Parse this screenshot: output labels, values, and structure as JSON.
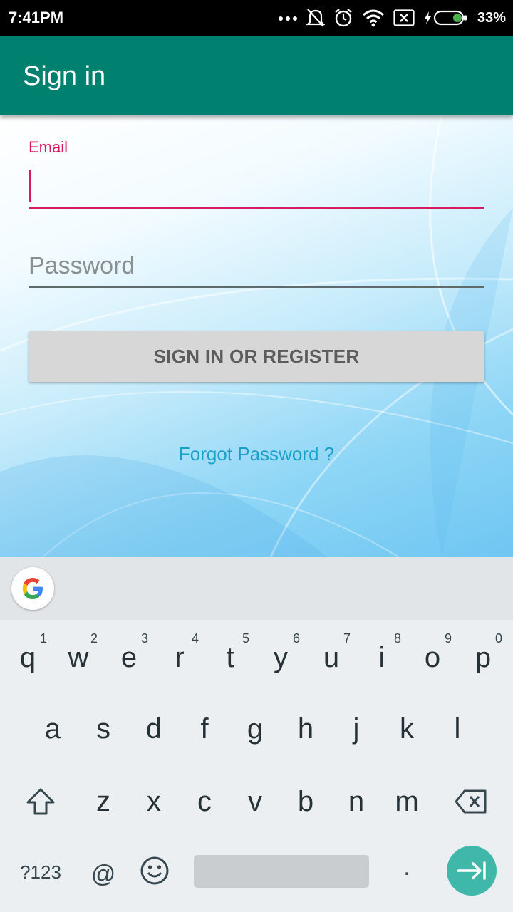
{
  "status_bar": {
    "time": "7:41PM",
    "battery": "33%"
  },
  "app_bar": {
    "title": "Sign in"
  },
  "form": {
    "email_label": "Email",
    "email_value": "",
    "password_placeholder": "Password",
    "submit_label": "SIGN IN OR REGISTER",
    "forgot_label": "Forgot Password ?"
  },
  "keyboard": {
    "row1": [
      {
        "key": "q",
        "hint": "1"
      },
      {
        "key": "w",
        "hint": "2"
      },
      {
        "key": "e",
        "hint": "3"
      },
      {
        "key": "r",
        "hint": "4"
      },
      {
        "key": "t",
        "hint": "5"
      },
      {
        "key": "y",
        "hint": "6"
      },
      {
        "key": "u",
        "hint": "7"
      },
      {
        "key": "i",
        "hint": "8"
      },
      {
        "key": "o",
        "hint": "9"
      },
      {
        "key": "p",
        "hint": "0"
      }
    ],
    "row2": [
      "a",
      "s",
      "d",
      "f",
      "g",
      "h",
      "j",
      "k",
      "l"
    ],
    "row3": [
      "z",
      "x",
      "c",
      "v",
      "b",
      "n",
      "m"
    ],
    "symbols_label": "?123",
    "at_label": "@",
    "period_label": "."
  },
  "colors": {
    "app_bar": "#00806f",
    "accent": "#d81b60",
    "link": "#1aa0c8",
    "enter_key": "#3fb8a9"
  }
}
